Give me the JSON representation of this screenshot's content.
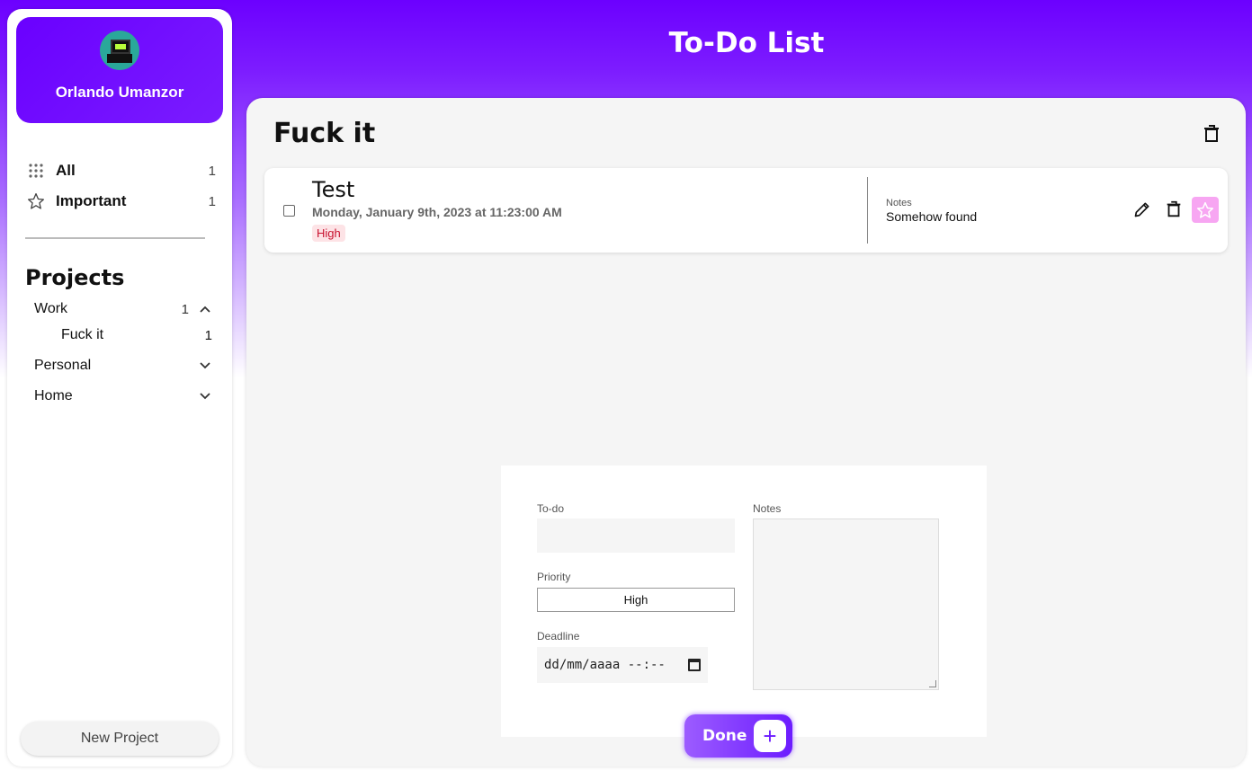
{
  "app": {
    "title": "To-Do List"
  },
  "profile": {
    "name": "Orlando Umanzor"
  },
  "nav": [
    {
      "label": "All",
      "count": "1",
      "icon": "grid-icon"
    },
    {
      "label": "Important",
      "count": "1",
      "icon": "star-icon"
    }
  ],
  "projects": {
    "title": "Projects",
    "items": [
      {
        "label": "Work",
        "count": "1",
        "expanded": true,
        "children": [
          {
            "label": "Fuck it",
            "count": "1"
          }
        ]
      },
      {
        "label": "Personal",
        "count": "",
        "expanded": false
      },
      {
        "label": "Home",
        "count": "",
        "expanded": false
      }
    ],
    "new_button": "New Project"
  },
  "main": {
    "title": "Fuck it",
    "todos": [
      {
        "title": "Test",
        "date": "Monday, January 9th, 2023 at 11:23:00 AM",
        "priority": "High",
        "notes_label": "Notes",
        "notes": "Somehow found",
        "important": true
      }
    ]
  },
  "form": {
    "todo_label": "To-do",
    "todo_value": "",
    "priority_label": "Priority",
    "priority_value": "High",
    "deadline_label": "Deadline",
    "deadline_placeholder": "dd/mm/aaaa --:--",
    "notes_label": "Notes",
    "notes_value": ""
  },
  "done_button": {
    "label": "Done",
    "plus": "+"
  },
  "colors": {
    "accent": "#6c00ff",
    "priority_high": "#c8102e",
    "star_bg": "#f7a6f2"
  }
}
